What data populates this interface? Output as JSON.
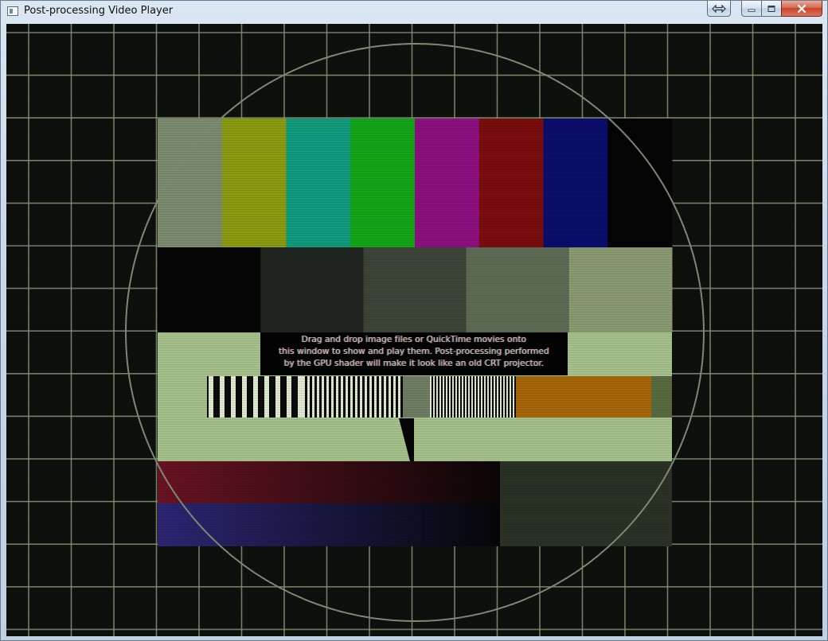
{
  "window": {
    "title": "Post-processing Video Player",
    "buttons": {
      "resize_icon": "resize-arrows-icon",
      "minimize_icon": "minimize-icon",
      "maximize_icon": "maximize-icon",
      "close_icon": "close-icon"
    }
  },
  "video": {
    "overlay_lines": [
      "Drag and drop image files or QuickTime movies onto",
      "this window to show and play them. Post-processing performed",
      "by the GPU shader will make it look like an old CRT projector."
    ],
    "colors": {
      "background": "#0d100c",
      "grid": "#8a977a",
      "circle": "#7f8d76",
      "bars": [
        "#7c8a70",
        "#8a9b12",
        "#119a7c",
        "#13a418",
        "#8c1080",
        "#7a0e0e",
        "#0b0d6c",
        "#040404"
      ],
      "gray_steps": [
        "#050505",
        "#1f241e",
        "#3c4438",
        "#5d6b55",
        "#8a9b72"
      ],
      "light_green": "#a6c08c",
      "orange": "#a8660a",
      "dark_red": "#6a1020",
      "dark_blue": "#2a2570",
      "dark_olive": "#2a3226"
    }
  }
}
